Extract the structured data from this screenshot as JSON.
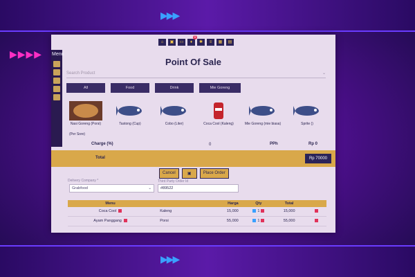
{
  "menu_label": "Menu",
  "title": "Point Of Sale",
  "search_placeholder": "Search Product",
  "toolbar": {
    "badge": "0"
  },
  "categories": [
    "All",
    "Food",
    "Drink",
    "Mie Goreng"
  ],
  "products": [
    {
      "name": "Nasi Goreng (Porsi)",
      "icon": "fried-rice-icon"
    },
    {
      "name": "Tastong (Cup)",
      "icon": "fish-icon"
    },
    {
      "name": "Cobo (Liter)",
      "icon": "fish-icon"
    },
    {
      "name": "Coca Cool (Kaleng)",
      "icon": "soda-can-icon"
    },
    {
      "name": "Mie Goreng (mie biasa)",
      "icon": "fish-icon"
    },
    {
      "name": "Sprite ()",
      "icon": "fish-icon"
    }
  ],
  "extras_label": "(Per Sore)",
  "charge_label": "Charge (%)",
  "charge_value": "0",
  "pph_label": "PPh",
  "pph_value": "Rp 0",
  "total_label": "Total",
  "total_value": "Rp 70000",
  "actions": {
    "cancel": "Cancel",
    "place_order": "Place Order"
  },
  "delivery_label": "Delivery Company *",
  "delivery_value": "Grabfood",
  "order_id_label": "Third Party Order Id",
  "order_id_value": "#89522",
  "table_headers": [
    "Menu",
    "Harga",
    "Qty",
    "Total"
  ],
  "rows": [
    {
      "menu": "Coca Cool",
      "unit": "Kaleng",
      "price": "15,000",
      "qty": "1",
      "total": "15,000"
    },
    {
      "menu": "Ayam Panggang",
      "unit": "Porsi",
      "price": "55,000",
      "qty": "1",
      "total": "55,000"
    }
  ],
  "colors": {
    "accent": "#d9a84a",
    "navy": "#2b2358",
    "panel": "#e8dced"
  }
}
